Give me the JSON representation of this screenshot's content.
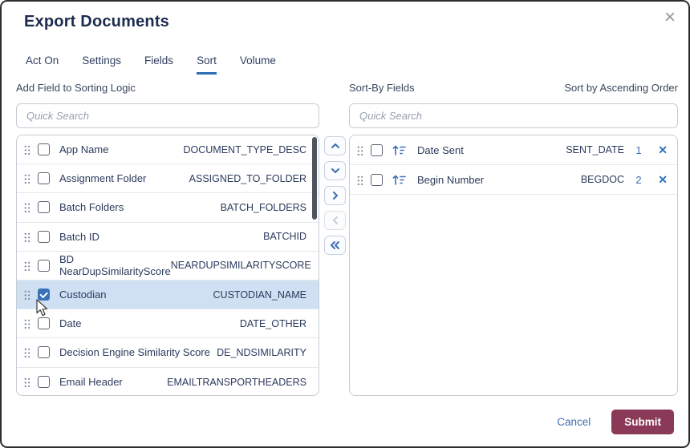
{
  "dialog": {
    "title": "Export Documents",
    "close_glyph": "×"
  },
  "tabs": [
    {
      "label": "Act On",
      "active": false
    },
    {
      "label": "Settings",
      "active": false
    },
    {
      "label": "Fields",
      "active": false
    },
    {
      "label": "Sort",
      "active": true
    },
    {
      "label": "Volume",
      "active": false
    }
  ],
  "left_panel": {
    "heading": "Add Field to Sorting Logic",
    "search": {
      "placeholder": "Quick Search",
      "value": ""
    },
    "fields": [
      {
        "name": "App Name",
        "code": "DOCUMENT_TYPE_DESC",
        "checked": false,
        "selected": false
      },
      {
        "name": "Assignment Folder",
        "code": "ASSIGNED_TO_FOLDER",
        "checked": false,
        "selected": false
      },
      {
        "name": "Batch Folders",
        "code": "BATCH_FOLDERS",
        "checked": false,
        "selected": false
      },
      {
        "name": "Batch ID",
        "code": "BATCHID",
        "checked": false,
        "selected": false
      },
      {
        "name": "BD NearDupSimilarityScore",
        "code": "NEARDUPSIMILARITYSCORE",
        "checked": false,
        "selected": false
      },
      {
        "name": "Custodian",
        "code": "CUSTODIAN_NAME",
        "checked": true,
        "selected": true
      },
      {
        "name": "Date",
        "code": "DATE_OTHER",
        "checked": false,
        "selected": false
      },
      {
        "name": "Decision Engine Similarity Score",
        "code": "DE_NDSIMILARITY",
        "checked": false,
        "selected": false
      },
      {
        "name": "Email Header",
        "code": "EMAILTRANSPORTHEADERS",
        "checked": false,
        "selected": false
      }
    ]
  },
  "transfer": {
    "buttons": [
      {
        "name": "move-up",
        "icon": "chevron-up",
        "disabled": false
      },
      {
        "name": "move-down",
        "icon": "chevron-down",
        "disabled": false
      },
      {
        "name": "move-to-sort",
        "icon": "chevron-right",
        "disabled": false
      },
      {
        "name": "remove-from-sort",
        "icon": "chevron-left",
        "disabled": true
      },
      {
        "name": "remove-all-from-sort",
        "icon": "double-chevron-left",
        "disabled": false
      }
    ]
  },
  "right_panel": {
    "heading": "Sort-By Fields",
    "order_note": "Sort by Ascending Order",
    "search": {
      "placeholder": "Quick Search",
      "value": ""
    },
    "remove_glyph": "✕",
    "fields": [
      {
        "name": "Date Sent",
        "code": "SENT_DATE",
        "order": "1",
        "checked": false,
        "sort_icon": "sort-ascending"
      },
      {
        "name": "Begin Number",
        "code": "BEGDOC",
        "order": "2",
        "checked": false,
        "sort_icon": "sort-ascending"
      }
    ]
  },
  "footer": {
    "cancel": "Cancel",
    "submit": "Submit"
  },
  "colors": {
    "accent_blue": "#2e6db4",
    "link_blue": "#3d6fb5",
    "submit_maroon": "#8a3a56",
    "selected_row_bg": "#cfe0f3",
    "checkbox_checked": "#3a71b8",
    "title_text": "#1d2b4f",
    "body_text": "#2b3a5c",
    "scrollbar_thumb": "#4f555e"
  }
}
